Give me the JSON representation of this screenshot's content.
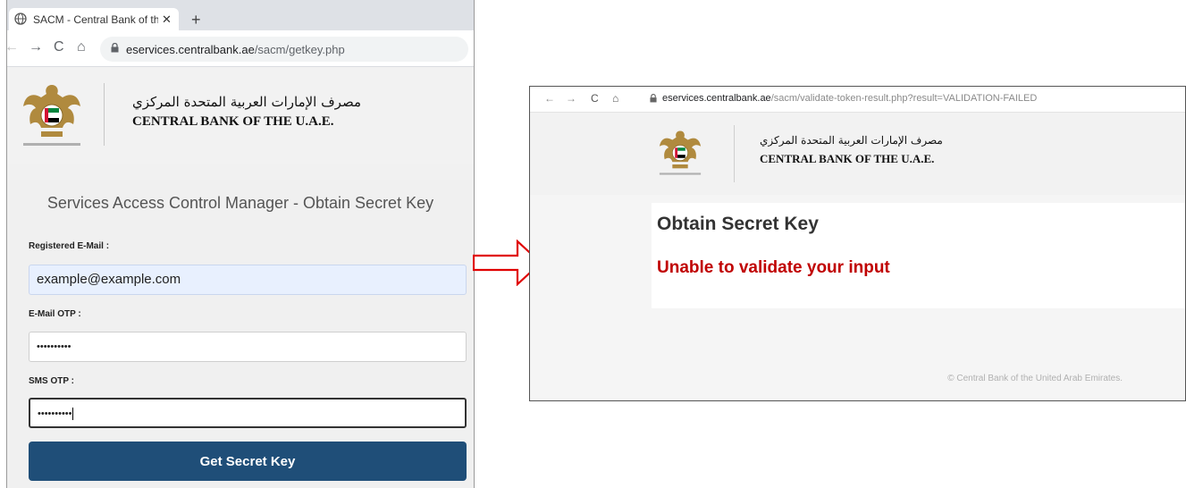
{
  "left_window": {
    "tab_title": "SACM - Central Bank of the U.A.E",
    "tab_close": "✕",
    "new_tab": "+",
    "url_host": "eservices.centralbank.ae",
    "url_path": "/sacm/getkey.php",
    "bank_name_ar": "مصرف الإمارات العربية المتحدة المركزي",
    "bank_name_en": "CENTRAL BANK OF THE U.A.E.",
    "form_title": "Services Access Control Manager - Obtain Secret Key",
    "email_label": "Registered E-Mail :",
    "email_value": "example@example.com",
    "email_otp_label": "E-Mail OTP :",
    "email_otp_value": "••••••••••",
    "sms_otp_label": "SMS OTP :",
    "sms_otp_value": "••••••••••",
    "submit_label": "Get Secret Key"
  },
  "right_window": {
    "url_host": "eservices.centralbank.ae",
    "url_path": "/sacm/validate-token-result.php?result=VALIDATION-FAILED",
    "bank_name_ar": "مصرف الإمارات العربية المتحدة المركزي",
    "bank_name_en": "CENTRAL BANK OF THE U.A.E.",
    "card_title": "Obtain Secret Key",
    "error_message": "Unable to validate your input",
    "footer": "© Central Bank of the United Arab Emirates."
  },
  "colors": {
    "submit_button": "#1f4e78",
    "error_text": "#c00000",
    "arrow": "#e00000"
  }
}
